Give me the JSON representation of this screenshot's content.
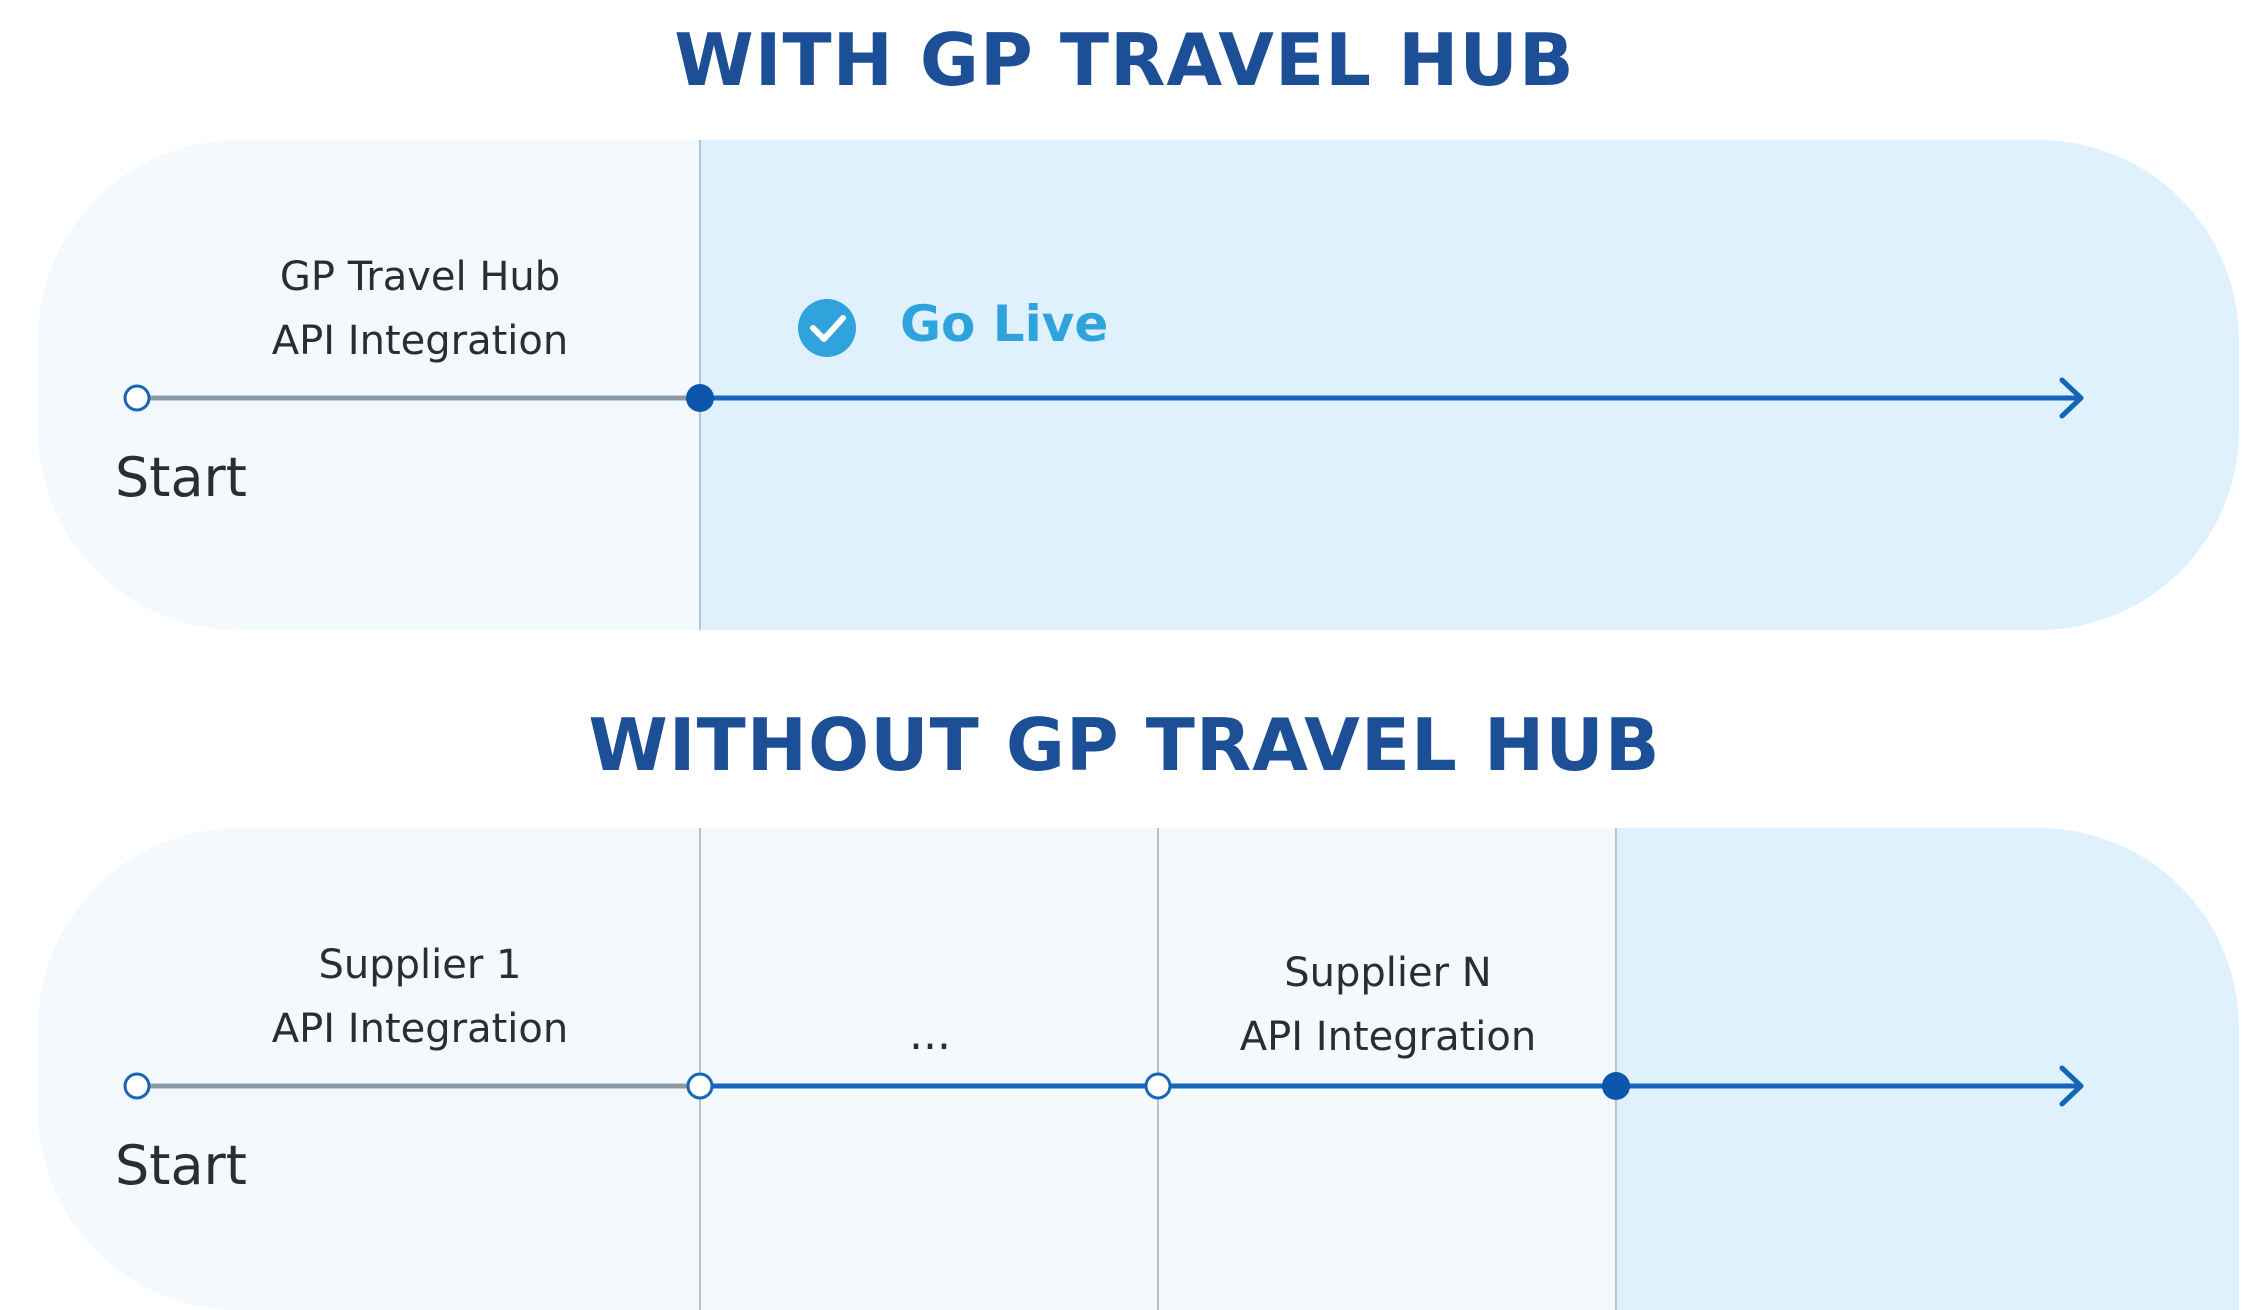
{
  "with": {
    "title": "WITH GP TRAVEL HUB",
    "step_line1": "GP Travel Hub",
    "step_line2": "API Integration",
    "go_live": "Go Live",
    "start": "Start"
  },
  "without": {
    "title": "WITHOUT GP TRAVEL HUB",
    "step1_line1": "Supplier 1",
    "step1_line2": "API Integration",
    "ellipsis": "...",
    "stepn_line1": "Supplier N",
    "stepn_line2": "API Integration",
    "start": "Start"
  },
  "colors": {
    "heading": "#1d4f96",
    "timeline_blue": "#1565b8",
    "timeline_gray": "#8c9aa6",
    "go_live": "#2ea3dc",
    "panel_light": "#f4f9fd",
    "panel_blue": "#dff1fc"
  }
}
